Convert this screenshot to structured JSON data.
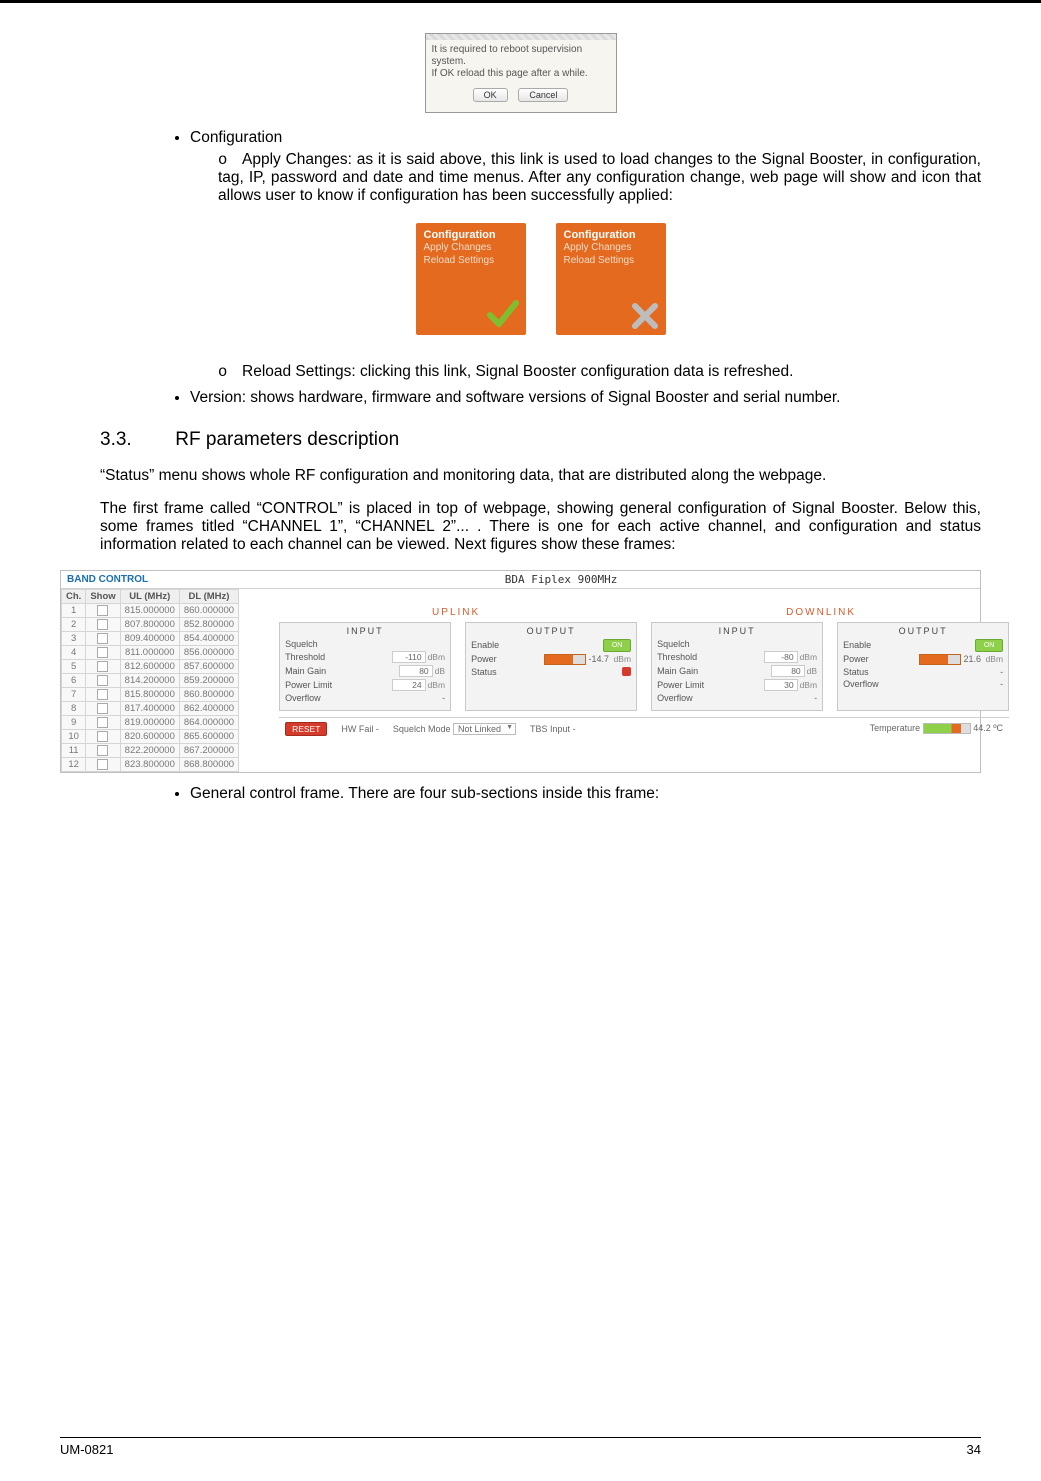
{
  "dialog": {
    "line1": "It is required to reboot supervision system.",
    "line2": "If OK reload this page after a while.",
    "ok": "OK",
    "cancel": "Cancel"
  },
  "bullets": {
    "configuration": "Configuration",
    "apply_changes": "Apply Changes: as it is said above, this link is used to load changes to the Signal Booster, in configuration, tag, IP, password and date and time menus. After any configuration change, web page will show and icon that allows user to know if configuration has been successfully applied:",
    "reload_settings": "Reload Settings: clicking this link, Signal Booster configuration data is refreshed.",
    "version": "Version: shows hardware, firmware and software versions of Signal Booster and serial number."
  },
  "cards": {
    "title": "Configuration",
    "line1": "Apply Changes",
    "line2": "Reload Settings"
  },
  "section": {
    "num": "3.3.",
    "title": "RF parameters description"
  },
  "para1": "“Status” menu shows whole RF configuration and monitoring data, that are distributed along the webpage.",
  "para2": "The first frame called “CONTROL” is placed in top of webpage, showing general configuration of Signal Booster. Below this, some frames titled “CHANNEL 1”, “CHANNEL 2”...  . There is one for each active channel, and configuration and status information related to each channel can be viewed. Next figures show these frames:",
  "panel": {
    "band_control": "BAND CONTROL",
    "device_title": "BDA Fiplex 900MHz",
    "headers": {
      "ch": "Ch.",
      "show": "Show",
      "ul": "UL (MHz)",
      "dl": "DL (MHz)"
    },
    "rows": [
      {
        "ch": "1",
        "ul": "815.000000",
        "dl": "860.000000"
      },
      {
        "ch": "2",
        "ul": "807.800000",
        "dl": "852.800000"
      },
      {
        "ch": "3",
        "ul": "809.400000",
        "dl": "854.400000"
      },
      {
        "ch": "4",
        "ul": "811.000000",
        "dl": "856.000000"
      },
      {
        "ch": "5",
        "ul": "812.600000",
        "dl": "857.600000"
      },
      {
        "ch": "6",
        "ul": "814.200000",
        "dl": "859.200000"
      },
      {
        "ch": "7",
        "ul": "815.800000",
        "dl": "860.800000"
      },
      {
        "ch": "8",
        "ul": "817.400000",
        "dl": "862.400000"
      },
      {
        "ch": "9",
        "ul": "819.000000",
        "dl": "864.000000"
      },
      {
        "ch": "10",
        "ul": "820.600000",
        "dl": "865.600000"
      },
      {
        "ch": "11",
        "ul": "822.200000",
        "dl": "867.200000"
      },
      {
        "ch": "12",
        "ul": "823.800000",
        "dl": "868.800000"
      }
    ],
    "uplink": "UPLINK",
    "downlink": "DOWNLINK",
    "input": "INPUT",
    "output": "OUTPUT",
    "squelch": "Squelch",
    "threshold": "Threshold",
    "main_gain": "Main Gain",
    "power_limit": "Power Limit",
    "overflow": "Overflow",
    "enable": "Enable",
    "power": "Power",
    "status": "Status",
    "on": "ON",
    "vals": {
      "th_ul": "-110",
      "th_dl": "-80",
      "gain_ul": "80",
      "gain_dl": "80",
      "plim_ul": "24",
      "plim_dl": "30",
      "pow_ul": "-14.7",
      "pow_dl": "21.6",
      "unit_dbm": "dBm",
      "unit_db": "dB"
    },
    "reset": "RESET",
    "hw_fail": "HW Fail",
    "squelch_mode": "Squelch Mode",
    "not_linked": "Not Linked",
    "tbs_input": "TBS Input",
    "temperature": "Temperature",
    "temp_val": "44.2",
    "temp_unit": "ºC",
    "dash": "-"
  },
  "bullet_general": "General control frame. There are four sub-sections inside this frame:",
  "footer": {
    "doc": "UM-0821",
    "page": "34"
  }
}
